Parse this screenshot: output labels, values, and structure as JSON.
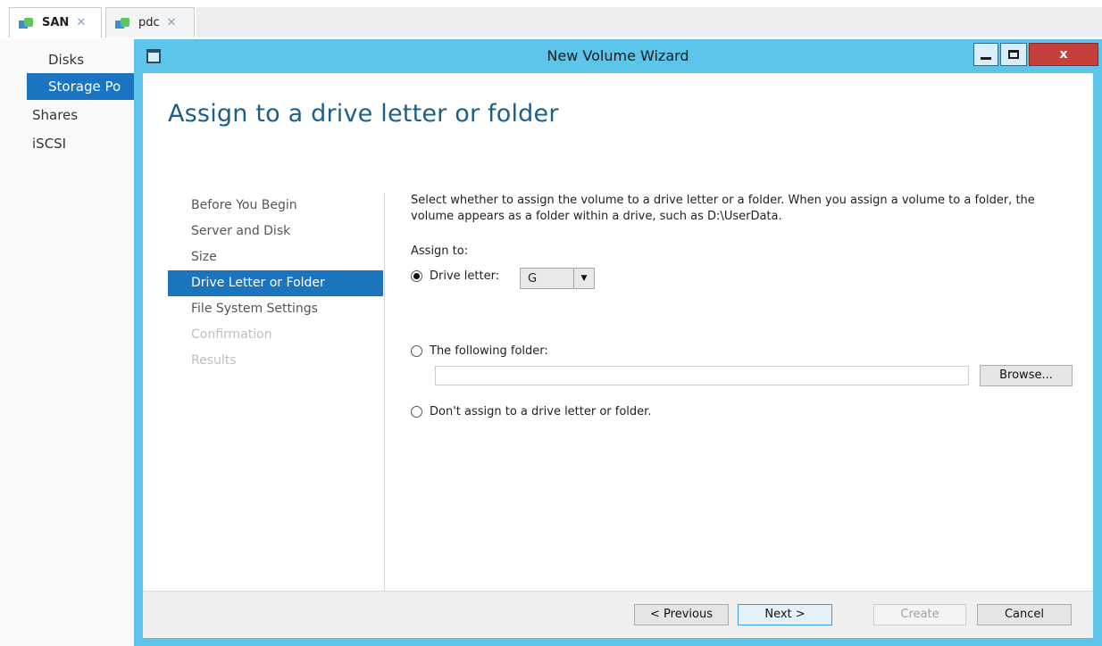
{
  "tabs": [
    {
      "label": "SAN",
      "close": "✕"
    },
    {
      "label": "pdc",
      "close": "✕"
    }
  ],
  "background_nav": {
    "items": [
      "Disks",
      "Storage Po",
      "Shares",
      "iSCSI"
    ]
  },
  "window": {
    "title": "New Volume Wizard",
    "close_glyph": "x"
  },
  "wizard": {
    "heading": "Assign to a drive letter or folder",
    "steps": [
      {
        "label": "Before You Begin",
        "state": "normal"
      },
      {
        "label": "Server and Disk",
        "state": "normal"
      },
      {
        "label": "Size",
        "state": "normal"
      },
      {
        "label": "Drive Letter or Folder",
        "state": "active"
      },
      {
        "label": "File System Settings",
        "state": "normal"
      },
      {
        "label": "Confirmation",
        "state": "disabled"
      },
      {
        "label": "Results",
        "state": "disabled"
      }
    ],
    "description": "Select whether to assign the volume to a drive letter or a folder. When you assign a volume to a folder, the volume appears as a folder within a drive, such as D:\\UserData.",
    "assign_label": "Assign to:",
    "options": {
      "drive_letter": "Drive letter:",
      "folder": "The following folder:",
      "none": "Don't assign to a drive letter or folder."
    },
    "selected_option": "drive_letter",
    "drive_letter_value": "G",
    "folder_value": "",
    "browse_label": "Browse...",
    "buttons": {
      "previous": "< Previous",
      "next": "Next >",
      "create": "Create",
      "cancel": "Cancel"
    }
  }
}
